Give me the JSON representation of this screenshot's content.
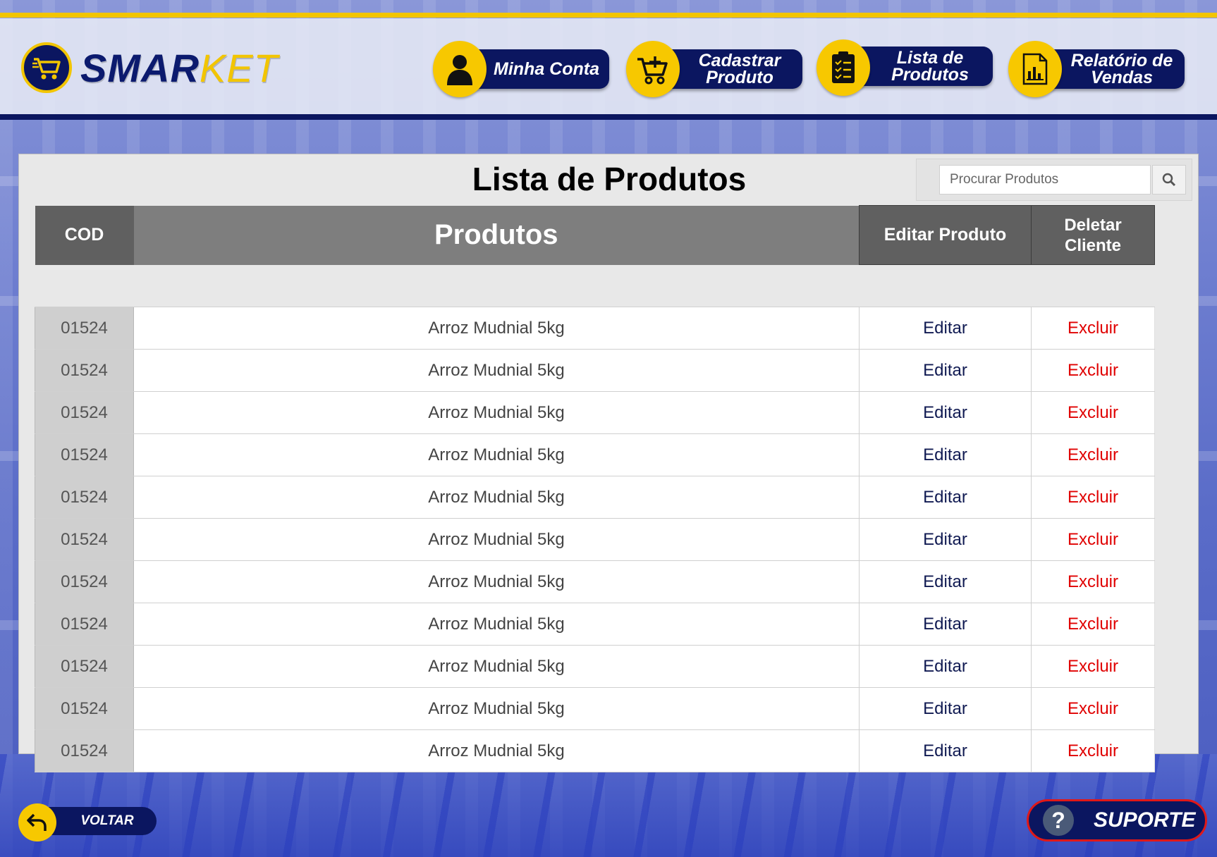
{
  "app": {
    "logo_main": "SMAR",
    "logo_accent": "KET",
    "logo_icon": "shopping-cart-icon"
  },
  "nav": {
    "items": [
      {
        "label_line1": "Minha Conta",
        "label_line2": "",
        "icon": "user-icon"
      },
      {
        "label_line1": "Cadastrar",
        "label_line2": "Produto",
        "icon": "cart-add-icon"
      },
      {
        "label_line1": "Lista de",
        "label_line2": "Produtos",
        "icon": "clipboard-list-icon"
      },
      {
        "label_line1": "Relatório de",
        "label_line2": "Vendas",
        "icon": "report-chart-icon"
      }
    ]
  },
  "page": {
    "title": "Lista de Produtos"
  },
  "search": {
    "placeholder": "Procurar Produtos",
    "icon": "search-icon"
  },
  "table": {
    "headers": {
      "cod": "COD",
      "produtos": "Produtos",
      "editar": "Editar Produto",
      "deletar_line1": "Deletar",
      "deletar_line2": "Cliente"
    },
    "rows": [
      {
        "cod": "01524",
        "produto": "Arroz Mudnial 5kg",
        "editar": "Editar",
        "excluir": "Excluir"
      },
      {
        "cod": "01524",
        "produto": "Arroz Mudnial 5kg",
        "editar": "Editar",
        "excluir": "Excluir"
      },
      {
        "cod": "01524",
        "produto": "Arroz Mudnial 5kg",
        "editar": "Editar",
        "excluir": "Excluir"
      },
      {
        "cod": "01524",
        "produto": "Arroz Mudnial 5kg",
        "editar": "Editar",
        "excluir": "Excluir"
      },
      {
        "cod": "01524",
        "produto": "Arroz Mudnial 5kg",
        "editar": "Editar",
        "excluir": "Excluir"
      },
      {
        "cod": "01524",
        "produto": "Arroz Mudnial 5kg",
        "editar": "Editar",
        "excluir": "Excluir"
      },
      {
        "cod": "01524",
        "produto": "Arroz Mudnial 5kg",
        "editar": "Editar",
        "excluir": "Excluir"
      },
      {
        "cod": "01524",
        "produto": "Arroz Mudnial 5kg",
        "editar": "Editar",
        "excluir": "Excluir"
      },
      {
        "cod": "01524",
        "produto": "Arroz Mudnial 5kg",
        "editar": "Editar",
        "excluir": "Excluir"
      },
      {
        "cod": "01524",
        "produto": "Arroz Mudnial 5kg",
        "editar": "Editar",
        "excluir": "Excluir"
      },
      {
        "cod": "01524",
        "produto": "Arroz Mudnial 5kg",
        "editar": "Editar",
        "excluir": "Excluir"
      }
    ]
  },
  "footer": {
    "back_label": "VOLTAR",
    "back_icon": "undo-arrow-icon",
    "support_label": "SUPORTE",
    "support_icon_glyph": "?",
    "support_icon": "question-icon"
  },
  "colors": {
    "brand_navy": "#0b1660",
    "brand_yellow": "#f7c800",
    "delete_red": "#e00000",
    "edit_navy": "#101a52"
  }
}
